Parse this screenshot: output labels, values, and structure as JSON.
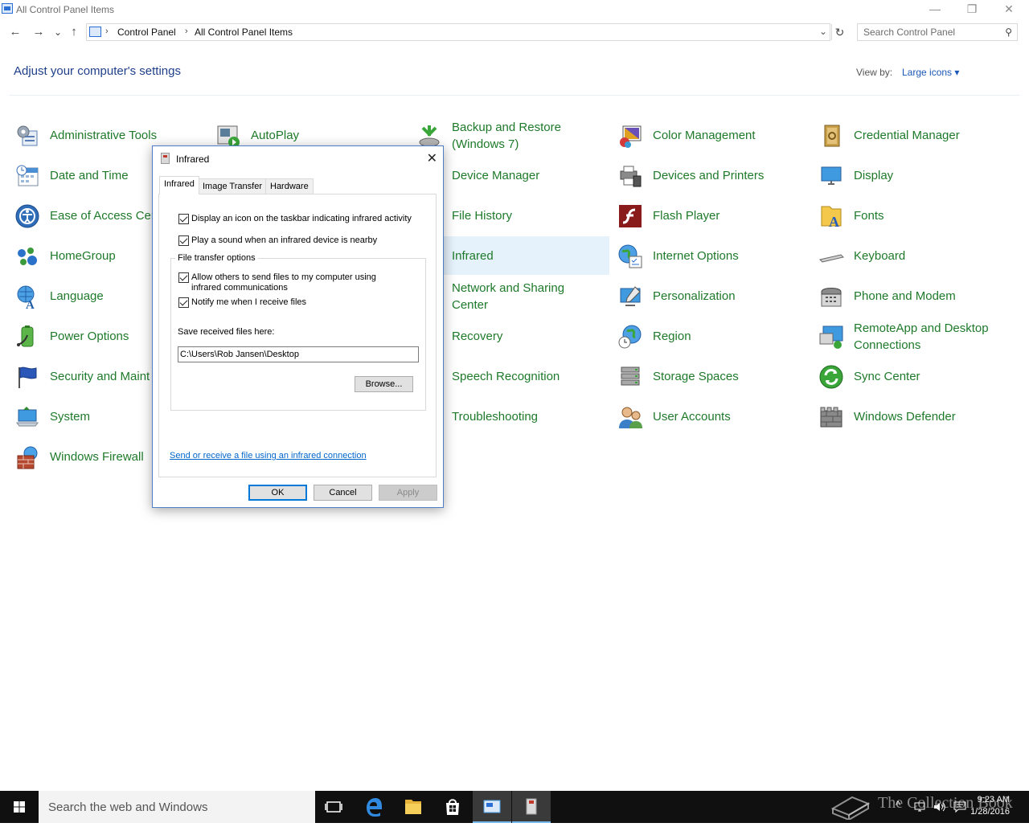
{
  "window": {
    "title": "All Control Panel Items",
    "minimize": "—",
    "restore": "❐",
    "close": "✕"
  },
  "address": {
    "back": "←",
    "forward": "→",
    "recent": "⌄",
    "up": "↑",
    "sep": "›",
    "crumbs": [
      "Control Panel",
      "All Control Panel Items"
    ],
    "dropdown": "⌄",
    "refresh": "↻",
    "search_placeholder": "Search Control Panel"
  },
  "main": {
    "heading": "Adjust your computer's settings",
    "view_by_label": "View by:",
    "view_by_value": "Large icons ▾"
  },
  "items": [
    {
      "label": "Administrative Tools",
      "icon": "admin-tools-icon"
    },
    {
      "label": "AutoPlay",
      "icon": "autoplay-icon"
    },
    {
      "label": "Backup and Restore (Windows 7)",
      "icon": "backup-restore-icon"
    },
    {
      "label": "Color Management",
      "icon": "color-management-icon"
    },
    {
      "label": "Credential Manager",
      "icon": "credential-manager-icon"
    },
    {
      "label": "Date and Time",
      "icon": "date-time-icon"
    },
    {
      "label": "Device Manager",
      "icon": "device-manager-icon"
    },
    {
      "label": "Devices and Printers",
      "icon": "devices-printers-icon"
    },
    {
      "label": "Display",
      "icon": "display-icon"
    },
    {
      "label": "Ease of Access Cen",
      "icon": "ease-of-access-icon"
    },
    {
      "label": "File History",
      "icon": "file-history-icon"
    },
    {
      "label": "Flash Player",
      "icon": "flash-player-icon"
    },
    {
      "label": "Fonts",
      "icon": "fonts-icon"
    },
    {
      "label": "HomeGroup",
      "icon": "homegroup-icon"
    },
    {
      "label": "Infrared",
      "icon": "infrared-icon"
    },
    {
      "label": "Internet Options",
      "icon": "internet-options-icon"
    },
    {
      "label": "Keyboard",
      "icon": "keyboard-icon"
    },
    {
      "label": "Language",
      "icon": "language-icon"
    },
    {
      "label": "Network and Sharing Center",
      "icon": "network-sharing-icon"
    },
    {
      "label": "Personalization",
      "icon": "personalization-icon"
    },
    {
      "label": "Phone and Modem",
      "icon": "phone-modem-icon"
    },
    {
      "label": "Power Options",
      "icon": "power-options-icon"
    },
    {
      "label": "Recovery",
      "icon": "recovery-icon"
    },
    {
      "label": "Region",
      "icon": "region-icon"
    },
    {
      "label": "RemoteApp and Desktop Connections",
      "icon": "remoteapp-icon"
    },
    {
      "label": "Security and Maint",
      "icon": "security-maintenance-icon"
    },
    {
      "label": "Speech Recognition",
      "icon": "speech-recognition-icon"
    },
    {
      "label": "Storage Spaces",
      "icon": "storage-spaces-icon"
    },
    {
      "label": "Sync Center",
      "icon": "sync-center-icon"
    },
    {
      "label": "System",
      "icon": "system-icon"
    },
    {
      "label": "Troubleshooting",
      "icon": "troubleshooting-icon"
    },
    {
      "label": "User Accounts",
      "icon": "user-accounts-icon"
    },
    {
      "label": "Windows Defender",
      "icon": "windows-defender-icon"
    },
    {
      "label": "Windows Firewall",
      "icon": "windows-firewall-icon"
    }
  ],
  "dialog": {
    "title": "Infrared",
    "close": "✕",
    "tabs": [
      "Infrared",
      "Image Transfer",
      "Hardware"
    ],
    "check_taskbar": "Display an icon on the taskbar indicating infrared activity",
    "check_sound": "Play a sound when an infrared device is nearby",
    "group_label": "File transfer options",
    "check_allow": "Allow others to send files to my computer using infrared communications",
    "check_notify": "Notify me when I receive files",
    "save_label": "Save received files here:",
    "save_path": "C:\\Users\\Rob Jansen\\Desktop",
    "browse": "Browse...",
    "link": "Send or receive a file using an infrared connection",
    "ok": "OK",
    "cancel": "Cancel",
    "apply": "Apply"
  },
  "taskbar": {
    "search_text": "Search the web and Windows",
    "time": "9:23 AM",
    "date": "1/28/2016",
    "tray_up": "^"
  },
  "watermark": "The Collection Book",
  "colors": {
    "link_green": "#1e7a2a",
    "heading_blue": "#1e3f8a",
    "highlight": "#e5f1fb",
    "taskbar": "#101010",
    "accent": "#0078d7"
  }
}
